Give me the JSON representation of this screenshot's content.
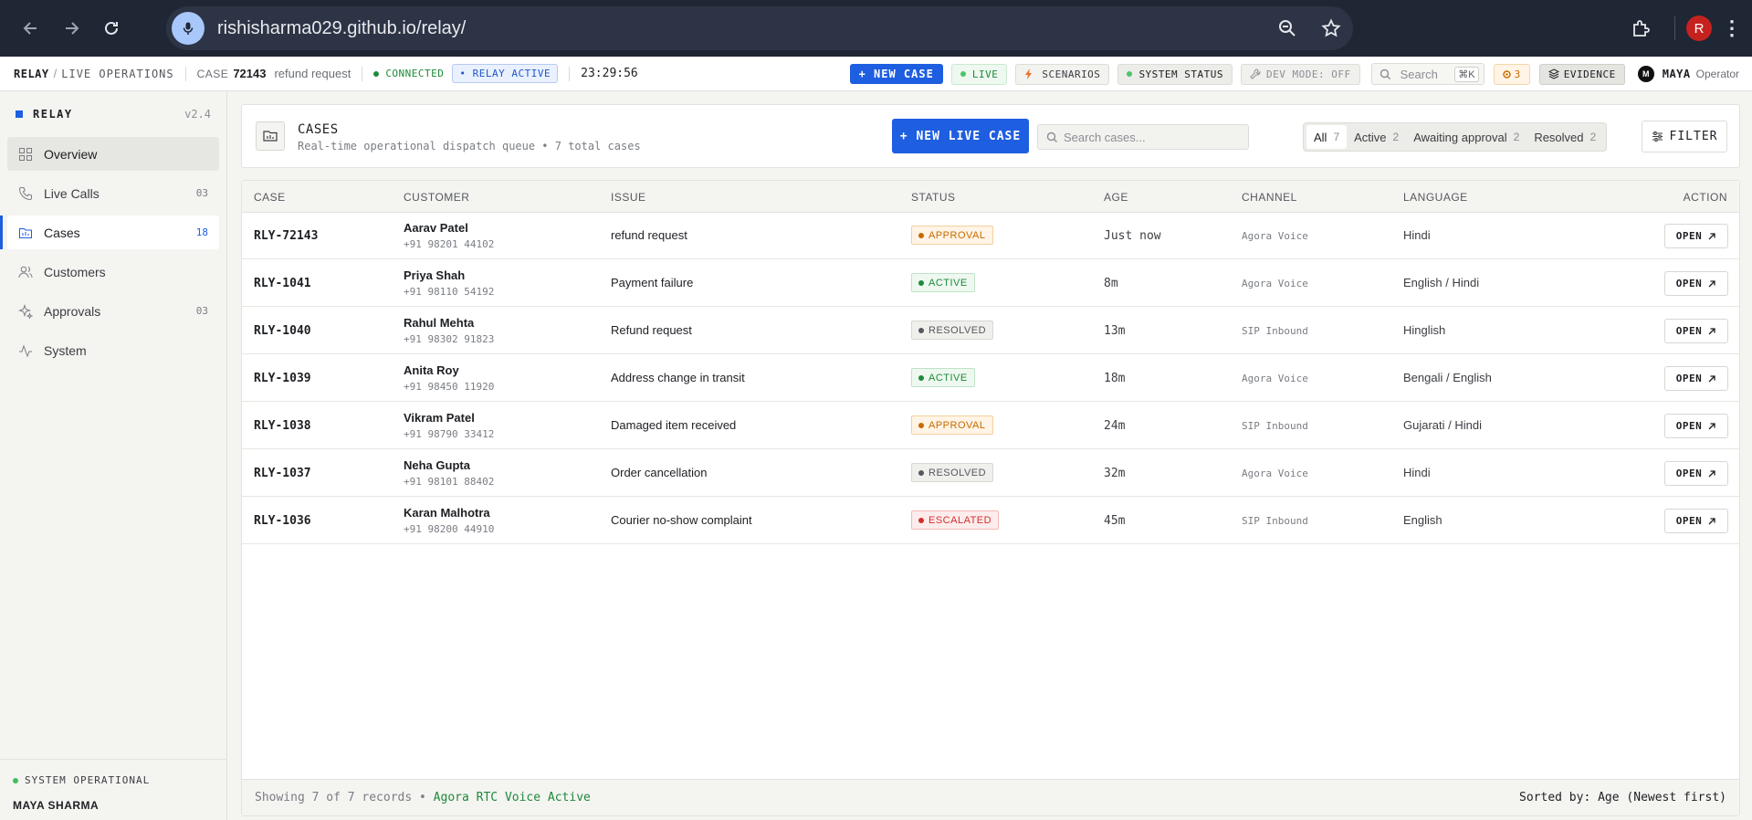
{
  "browser": {
    "url": "rishisharma029.github.io/relay/",
    "profile_initial": "R"
  },
  "topbar": {
    "brand": "RELAY",
    "section": "LIVE OPERATIONS",
    "case_label": "CASE",
    "case_id": "72143",
    "case_issue": "refund request",
    "connection": "CONNECTED",
    "relay_status": "• RELAY ACTIVE",
    "clock": "23:29:56",
    "new_case": "+ NEW CASE",
    "live": "LIVE",
    "scenarios": "SCENARIOS",
    "system_status": "SYSTEM STATUS",
    "dev_mode": "DEV MODE: OFF",
    "search_placeholder": "Search",
    "search_shortcut": "⌘K",
    "notification_count": "3",
    "evidence": "EVIDENCE",
    "user_initial": "M",
    "user_name": "MAYA",
    "user_role": "Operator"
  },
  "sidebar": {
    "brand": "RELAY",
    "version": "v2.4",
    "items": [
      {
        "label": "Overview",
        "count": ""
      },
      {
        "label": "Live Calls",
        "count": "03"
      },
      {
        "label": "Cases",
        "count": "18"
      },
      {
        "label": "Customers",
        "count": ""
      },
      {
        "label": "Approvals",
        "count": "03"
      },
      {
        "label": "System",
        "count": ""
      }
    ],
    "footer_status": "SYSTEM OPERATIONAL",
    "footer_user": "MAYA SHARMA"
  },
  "cases_header": {
    "title": "CASES",
    "subtitle": "Real-time operational dispatch queue • 7 total cases",
    "new_live_case": "+ NEW LIVE CASE",
    "search_placeholder": "Search cases...",
    "filters": [
      {
        "label": "All",
        "count": "7"
      },
      {
        "label": "Active",
        "count": "2"
      },
      {
        "label": "Awaiting approval",
        "count": "2"
      },
      {
        "label": "Resolved",
        "count": "2"
      }
    ],
    "filter_button": "FILTER"
  },
  "table": {
    "columns": [
      "CASE",
      "CUSTOMER",
      "ISSUE",
      "STATUS",
      "AGE",
      "CHANNEL",
      "LANGUAGE",
      "ACTION"
    ],
    "rows": [
      {
        "case": "RLY-72143",
        "name": "Aarav Patel",
        "phone": "+91 98201 44102",
        "issue": "refund request",
        "status": "APPROVAL",
        "age": "Just now",
        "channel": "Agora Voice",
        "language": "Hindi",
        "action": "OPEN"
      },
      {
        "case": "RLY-1041",
        "name": "Priya Shah",
        "phone": "+91 98110 54192",
        "issue": "Payment failure",
        "status": "ACTIVE",
        "age": "8m",
        "channel": "Agora Voice",
        "language": "English / Hindi",
        "action": "OPEN"
      },
      {
        "case": "RLY-1040",
        "name": "Rahul Mehta",
        "phone": "+91 98302 91823",
        "issue": "Refund request",
        "status": "RESOLVED",
        "age": "13m",
        "channel": "SIP Inbound",
        "language": "Hinglish",
        "action": "OPEN"
      },
      {
        "case": "RLY-1039",
        "name": "Anita Roy",
        "phone": "+91 98450 11920",
        "issue": "Address change in transit",
        "status": "ACTIVE",
        "age": "18m",
        "channel": "Agora Voice",
        "language": "Bengali / English",
        "action": "OPEN"
      },
      {
        "case": "RLY-1038",
        "name": "Vikram Patel",
        "phone": "+91 98790 33412",
        "issue": "Damaged item received",
        "status": "APPROVAL",
        "age": "24m",
        "channel": "SIP Inbound",
        "language": "Gujarati / Hindi",
        "action": "OPEN"
      },
      {
        "case": "RLY-1037",
        "name": "Neha Gupta",
        "phone": "+91 98101 88402",
        "issue": "Order cancellation",
        "status": "RESOLVED",
        "age": "32m",
        "channel": "Agora Voice",
        "language": "Hindi",
        "action": "OPEN"
      },
      {
        "case": "RLY-1036",
        "name": "Karan Malhotra",
        "phone": "+91 98200 44910",
        "issue": "Courier no-show complaint",
        "status": "ESCALATED",
        "age": "45m",
        "channel": "SIP Inbound",
        "language": "English",
        "action": "OPEN"
      }
    ],
    "footer_count": "Showing 7 of 7 records",
    "footer_voice": "Agora RTC Voice Active",
    "footer_sort": "Sorted by: Age (Newest first)"
  },
  "colors": {
    "accent": "#1e5ee0",
    "approval": "#c76a00",
    "active": "#1e8a3a",
    "resolved": "#55585e",
    "escalated": "#d0302f"
  }
}
